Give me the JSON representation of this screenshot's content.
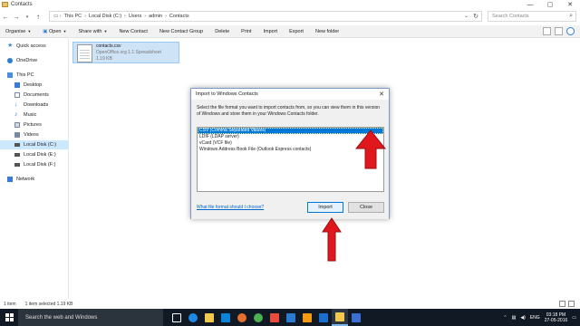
{
  "window": {
    "title": "Contacts",
    "controls": {
      "minimize": "—",
      "maximize": "▢",
      "close": "✕"
    }
  },
  "address": {
    "crumbs": [
      "This PC",
      "Local Disk (C:)",
      "Users",
      "admin",
      "Contacts"
    ],
    "search_placeholder": "Search Contacts"
  },
  "toolbar": {
    "items": [
      "Organise",
      "Open",
      "Share with",
      "New Contact",
      "New Contact Group",
      "Delete",
      "Print",
      "Import",
      "Export",
      "New folder"
    ]
  },
  "sidebar": {
    "items": [
      {
        "label": "Quick access",
        "icon": "star-icon",
        "color": "#3c8ad9"
      },
      {
        "label": "OneDrive",
        "icon": "cloud-icon",
        "color": "#2d7fd6"
      },
      {
        "label": "This PC",
        "icon": "computer-icon",
        "color": "#4a90d9"
      },
      {
        "label": "Desktop",
        "icon": "desktop-icon",
        "color": "#3a7bd5"
      },
      {
        "label": "Documents",
        "icon": "documents-icon",
        "color": "#7a8aa0"
      },
      {
        "label": "Downloads",
        "icon": "downloads-icon",
        "color": "#2d7fd6"
      },
      {
        "label": "Music",
        "icon": "music-icon",
        "color": "#2d7fd6"
      },
      {
        "label": "Pictures",
        "icon": "pictures-icon",
        "color": "#7a8aa0"
      },
      {
        "label": "Videos",
        "icon": "videos-icon",
        "color": "#7a8aa0"
      },
      {
        "label": "Local Disk (C:)",
        "icon": "disk-icon",
        "color": "#555555"
      },
      {
        "label": "Local Disk (E:)",
        "icon": "disk-icon",
        "color": "#555555"
      },
      {
        "label": "Local Disk (F:)",
        "icon": "disk-icon",
        "color": "#555555"
      },
      {
        "label": "Network",
        "icon": "network-icon",
        "color": "#3a7bd5"
      }
    ],
    "selected": "Local Disk (C:)"
  },
  "file": {
    "name": "contacts.csv",
    "type": "OpenOffice.org 1.1 Spreadsheet",
    "size": "1.19 KB"
  },
  "status": {
    "count": "1 item",
    "selected": "1 item selected  1.19 KB"
  },
  "dialog": {
    "title": "Import to Windows Contacts",
    "description": "Select the file format you want to import contacts from, so you can view them in this version of Windows and store them in your Windows Contacts folder.",
    "options": [
      "CSV (Comma Separated Values)",
      "LDIF (LDAP server)",
      "vCard (VCF file)",
      "Windows Address Book File (Outlook Express contacts)"
    ],
    "selected_option": "CSV (Comma Separated Values)",
    "help_link": "What file format should I choose?",
    "import_label": "Import",
    "close_label": "Close"
  },
  "taskbar": {
    "search_text": "Search the web and Windows",
    "language": "ENG",
    "time": "03:18 PM",
    "date": "27-05-2016",
    "apps": [
      {
        "name": "task-view-icon",
        "color": "#ffffff"
      },
      {
        "name": "edge-icon",
        "color": "#1e88e5"
      },
      {
        "name": "file-explorer-icon",
        "color": "#f2c94c"
      },
      {
        "name": "store-icon",
        "color": "#0b84d8"
      },
      {
        "name": "firefox-icon",
        "color": "#e76f2d"
      },
      {
        "name": "chrome-icon",
        "color": "#4caf50"
      },
      {
        "name": "app-icon",
        "color": "#e74c3c"
      },
      {
        "name": "app-icon",
        "color": "#2b7bd1"
      },
      {
        "name": "vlc-icon",
        "color": "#f39c12"
      },
      {
        "name": "app-icon",
        "color": "#1c6fd1"
      },
      {
        "name": "contacts-window-icon",
        "color": "#f2c94c"
      },
      {
        "name": "app-icon",
        "color": "#3c6fd1"
      }
    ]
  },
  "annotation_color": "#e0171c"
}
